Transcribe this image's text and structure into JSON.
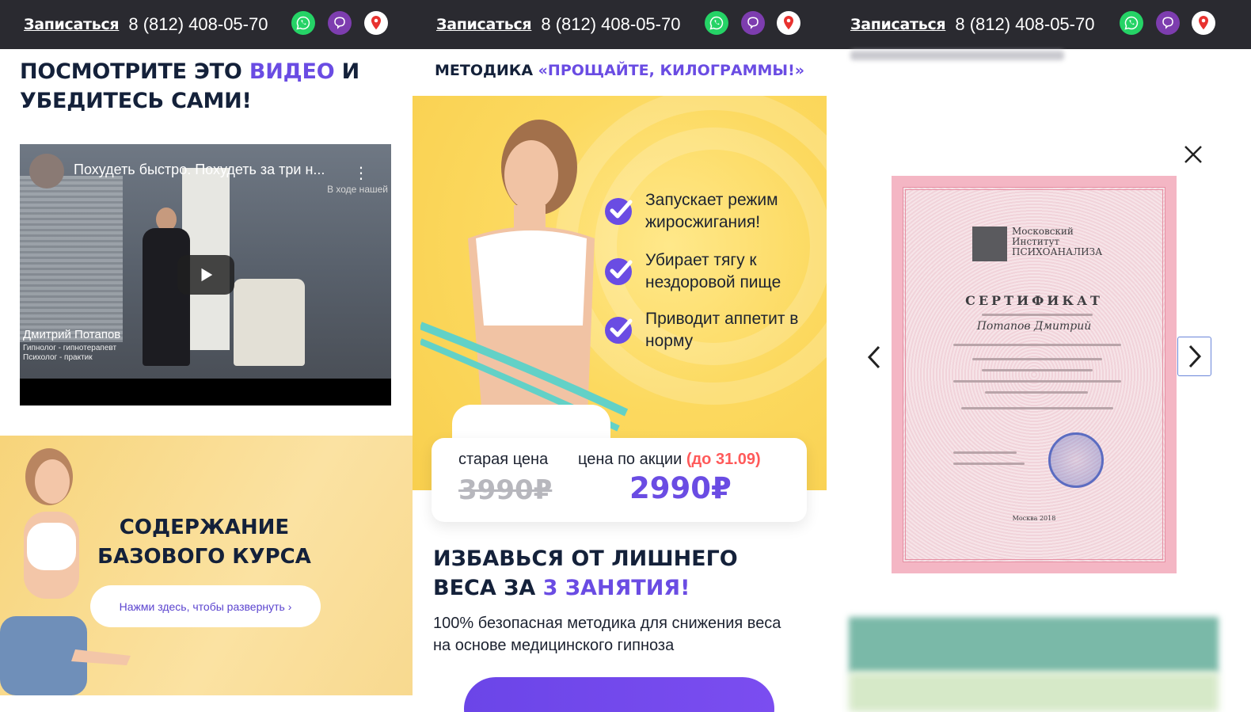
{
  "topbar": {
    "signup_label": "Записаться",
    "phone": "8 (812) 408-05-70",
    "icons": [
      "whatsapp-icon",
      "viber-icon",
      "map-pin-icon"
    ],
    "colors": {
      "background": "#2a2a30",
      "whatsapp": "#25d366",
      "viber": "#7d3daf",
      "map_pin": "#e8322f"
    }
  },
  "video_section": {
    "title_part1": "ПОСМОТРИТЕ ЭТО ",
    "title_accent": "ВИДЕО",
    "title_part2": " И УБЕДИТЕСЬ САМИ!",
    "video": {
      "title": "Похудеть быстро. Похудеть за три н...",
      "subtitle": "В ходе нашей",
      "speaker_name": "Дмитрий Потапов",
      "speaker_role1": "Гипнолог - гипнотерапевт",
      "speaker_role2": "Психолог - практик"
    }
  },
  "course": {
    "title": "СОДЕРЖАНИЕ БАЗОВОГО КУРСА",
    "expand_label": "Нажми здесь, чтобы развернуть ›"
  },
  "method": {
    "label": "МЕТОДИКА ",
    "name": "«ПРОЩАЙТЕ, КИЛОГРАММЫ!»"
  },
  "benefits": [
    "Запускает режим жиросжигания!",
    "Убирает тягу к нездоровой пище",
    "Приводит аппетит в норму"
  ],
  "pricing": {
    "old_label": "старая цена",
    "old_price": "3990₽",
    "new_label": "цена по акции ",
    "deadline": "(до 31.09)",
    "new_price": "2990₽"
  },
  "rid": {
    "title_part1": "ИЗБАВЬСЯ ОТ ЛИШНЕГО ВЕСА ЗА ",
    "title_accent": "3 ЗАНЯТИЯ!",
    "description": "100% безопасная методика для снижения веса на основе медицинского гипноза"
  },
  "certificate": {
    "org_line1": "Московский",
    "org_line2": "Институт",
    "org_line3": "ПСИХОАНАЛИЗА",
    "title": "СЕРТИФИКАТ",
    "holder": "Потапов Дмитрий",
    "city": "Москва 2018"
  },
  "accent_color": "#6a4ce3"
}
